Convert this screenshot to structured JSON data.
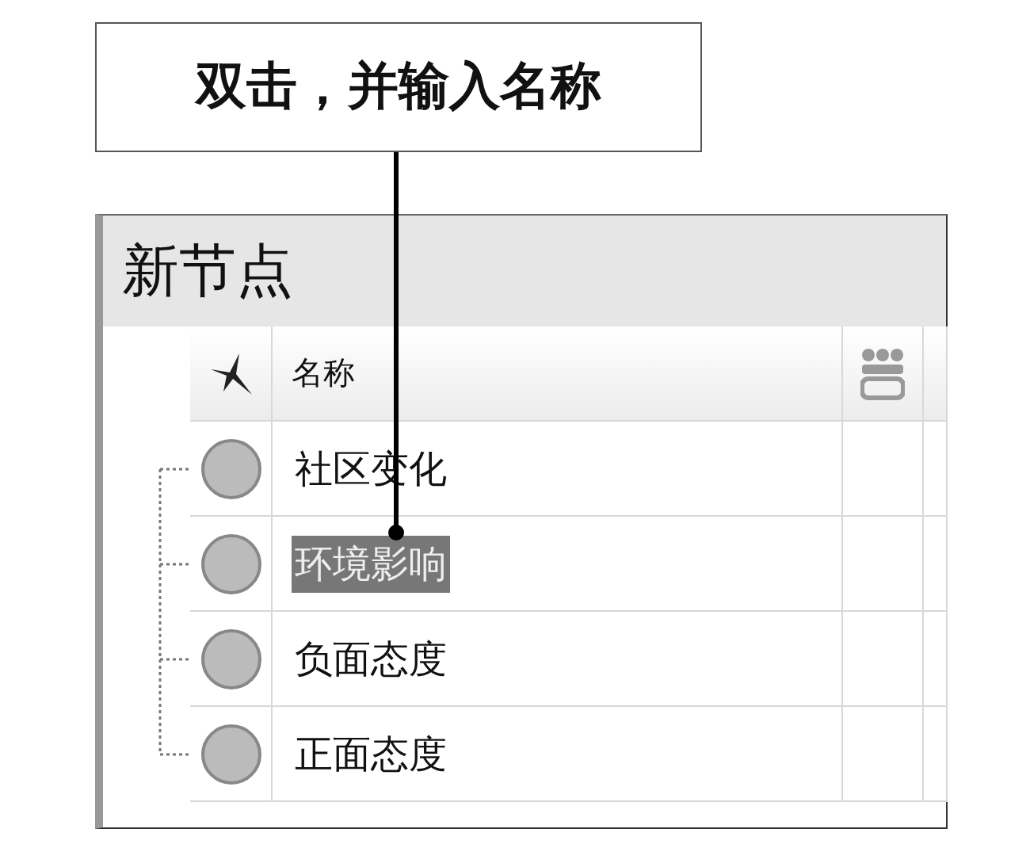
{
  "callout": {
    "text": "双击，并输入名称"
  },
  "panel": {
    "title": "新节点"
  },
  "table": {
    "columns": [
      {
        "label": "名称"
      }
    ],
    "rows": [
      {
        "name": "社区变化",
        "selected": false
      },
      {
        "name": "环境影响",
        "selected": true
      },
      {
        "name": "负面态度",
        "selected": false
      },
      {
        "name": "正面态度",
        "selected": false
      }
    ]
  }
}
